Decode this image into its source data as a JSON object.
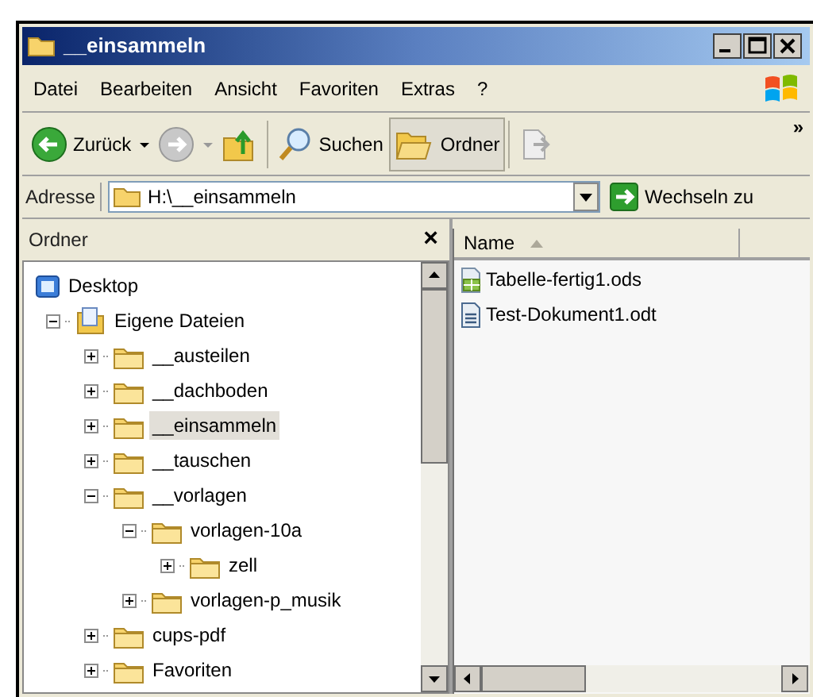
{
  "window": {
    "title": "__einsammeln"
  },
  "menu": [
    "Datei",
    "Bearbeiten",
    "Ansicht",
    "Favoriten",
    "Extras",
    "?"
  ],
  "toolbar": {
    "buttons": [
      {
        "kind": "back",
        "label": "Zurück",
        "disabled": false,
        "selected": false
      },
      {
        "kind": "forward",
        "disabled": true,
        "selected": false
      },
      {
        "kind": "up",
        "disabled": false,
        "selected": false
      },
      {
        "kind": "search",
        "label": "Suchen",
        "disabled": false,
        "selected": false
      },
      {
        "kind": "folders",
        "label": "Ordner",
        "disabled": false,
        "selected": true
      },
      {
        "kind": "move",
        "disabled": true,
        "selected": false
      }
    ],
    "more": "»"
  },
  "address": {
    "label": "Adresse",
    "value": "H:\\__einsammeln",
    "go": "Wechseln zu"
  },
  "folder_pane": {
    "title": "Ordner",
    "close": "×",
    "tree": [
      {
        "label": "Desktop",
        "kind": "desktop",
        "selected": false,
        "children": [
          {
            "label": "Eigene Dateien",
            "kind": "documents",
            "expanded": true,
            "selected": false,
            "children": [
              {
                "label": "__austeilen",
                "kind": "folder",
                "expanded": false,
                "selected": false
              },
              {
                "label": "__dachboden",
                "kind": "folder",
                "expanded": false,
                "selected": false
              },
              {
                "label": "__einsammeln",
                "kind": "folder",
                "expanded": false,
                "selected": true
              },
              {
                "label": "__tauschen",
                "kind": "folder",
                "expanded": false,
                "selected": false
              },
              {
                "label": "__vorlagen",
                "kind": "folder",
                "expanded": true,
                "selected": false,
                "children": [
                  {
                    "label": "vorlagen-10a",
                    "kind": "folder",
                    "expanded": true,
                    "selected": false,
                    "children": [
                      {
                        "label": "zell",
                        "kind": "folder",
                        "expanded": false,
                        "selected": false
                      }
                    ]
                  },
                  {
                    "label": "vorlagen-p_musik",
                    "kind": "folder",
                    "expanded": false,
                    "selected": false
                  }
                ]
              },
              {
                "label": "cups-pdf",
                "kind": "folder",
                "expanded": false,
                "selected": false
              },
              {
                "label": "Favoriten",
                "kind": "folder",
                "expanded": false,
                "selected": false
              }
            ]
          }
        ]
      }
    ]
  },
  "files": {
    "columns": [
      {
        "label": "Name",
        "sorted": true
      }
    ],
    "items": [
      {
        "name": "Tabelle-fertig1.ods",
        "kind": "spreadsheet"
      },
      {
        "name": "Test-Dokument1.odt",
        "kind": "text"
      }
    ]
  }
}
